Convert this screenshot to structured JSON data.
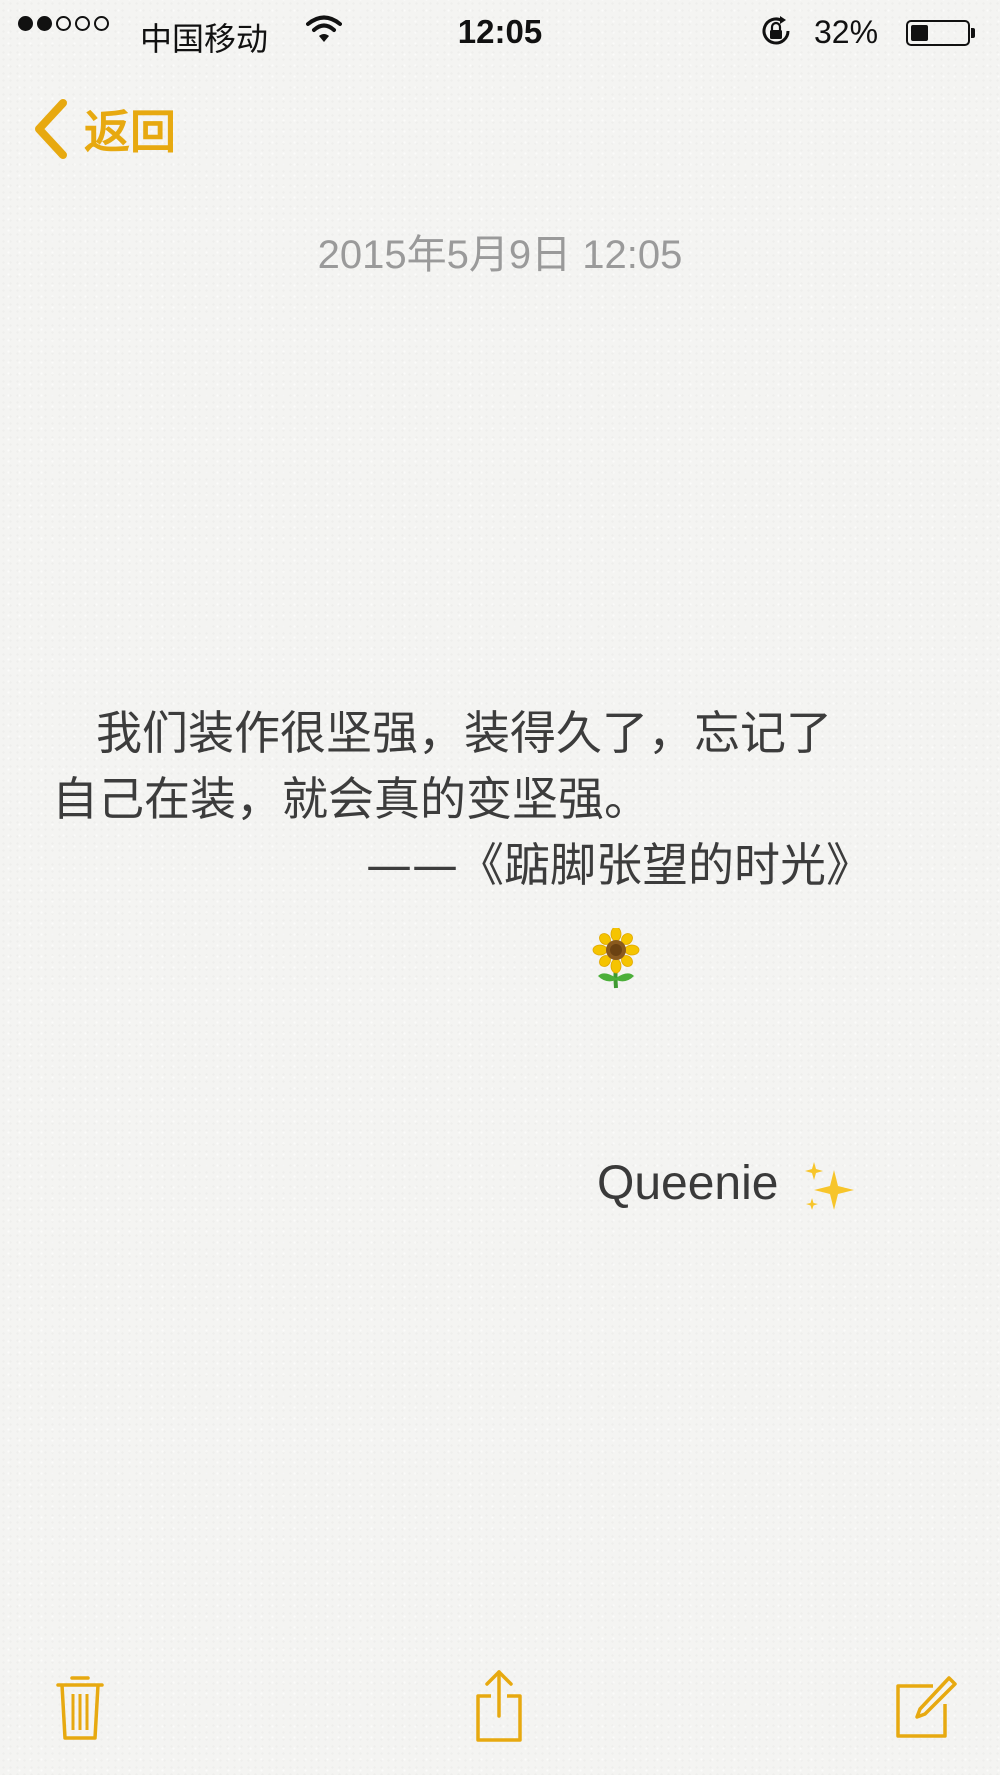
{
  "status_bar": {
    "signal_filled": 2,
    "signal_total": 5,
    "carrier": "中国移动",
    "time": "12:05",
    "battery_percent": "32%",
    "battery_level": 0.32
  },
  "nav": {
    "back_label": "返回",
    "accent_color": "#e7a910"
  },
  "note": {
    "date": "2015年5月9日 12:05",
    "line1": "我们装作很坚强，装得久了，忘记了",
    "line2": "自己在装，就会真的变坚强。",
    "line3": "——《踮脚张望的时光》",
    "signature": "Queenie"
  },
  "icons": {
    "back": "chevron-left-icon",
    "trash": "trash-icon",
    "share": "share-icon",
    "compose": "compose-icon",
    "sunflower": "sunflower-emoji",
    "sparkles": "sparkles-emoji",
    "wifi": "wifi-icon",
    "rotation_lock": "rotation-lock-icon",
    "battery": "battery-icon"
  }
}
